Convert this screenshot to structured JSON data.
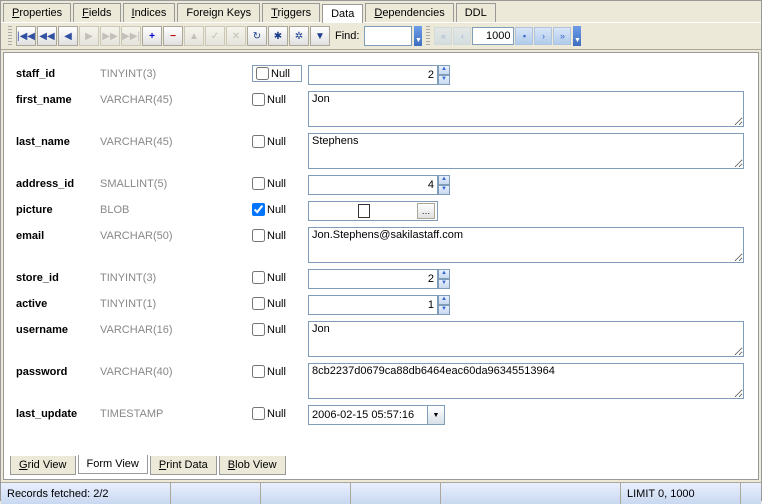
{
  "tabs_top": {
    "properties": "Properties",
    "fields": "Fields",
    "indices": "Indices",
    "foreign_keys": "Foreign Keys",
    "triggers": "Triggers",
    "data": "Data",
    "dependencies": "Dependencies",
    "ddl": "DDL"
  },
  "toolbar": {
    "find_label": "Find:",
    "find_value": "",
    "pager_value": "1000"
  },
  "null_label": "Null",
  "fields": {
    "staff_id": {
      "name": "staff_id",
      "type": "TINYINT(3)",
      "null": false,
      "value": "2"
    },
    "first_name": {
      "name": "first_name",
      "type": "VARCHAR(45)",
      "null": false,
      "value": "Jon"
    },
    "last_name": {
      "name": "last_name",
      "type": "VARCHAR(45)",
      "null": false,
      "value": "Stephens"
    },
    "address_id": {
      "name": "address_id",
      "type": "SMALLINT(5)",
      "null": false,
      "value": "4"
    },
    "picture": {
      "name": "picture",
      "type": "BLOB",
      "null": true,
      "value": ""
    },
    "email": {
      "name": "email",
      "type": "VARCHAR(50)",
      "null": false,
      "value": "Jon.Stephens@sakilastaff.com"
    },
    "store_id": {
      "name": "store_id",
      "type": "TINYINT(3)",
      "null": false,
      "value": "2"
    },
    "active": {
      "name": "active",
      "type": "TINYINT(1)",
      "null": false,
      "value": "1"
    },
    "username": {
      "name": "username",
      "type": "VARCHAR(16)",
      "null": false,
      "value": "Jon"
    },
    "password": {
      "name": "password",
      "type": "VARCHAR(40)",
      "null": false,
      "value": "8cb2237d0679ca88db6464eac60da96345513964"
    },
    "last_update": {
      "name": "last_update",
      "type": "TIMESTAMP",
      "null": false,
      "value": "2006-02-15 05:57:16"
    }
  },
  "tabs_bottom": {
    "grid_view": "Grid View",
    "form_view": "Form View",
    "print_data": "Print Data",
    "blob_view": "Blob View"
  },
  "status": {
    "records": "Records fetched: 2/2",
    "limit": "LIMIT 0, 1000"
  }
}
